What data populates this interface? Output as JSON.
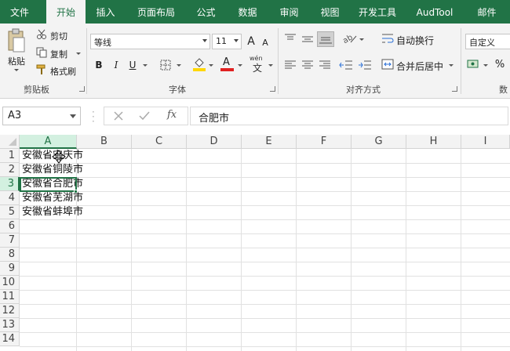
{
  "tabs": [
    "文件",
    "开始",
    "插入",
    "页面布局",
    "公式",
    "数据",
    "审阅",
    "视图",
    "开发工具",
    "AudTool",
    "邮件"
  ],
  "active_tab": "开始",
  "clipboard": {
    "paste": "粘贴",
    "cut": "剪切",
    "copy": "复制",
    "format_painter": "格式刷",
    "group": "剪贴板"
  },
  "font": {
    "name": "等线",
    "size": "11",
    "grow": "A",
    "shrink": "A",
    "bold": "B",
    "italic": "I",
    "underline": "U",
    "font_color": "A",
    "phonetic": "wén",
    "group": "字体"
  },
  "alignment": {
    "wrap_text": "自动换行",
    "merge_center": "合并后居中",
    "group": "对齐方式"
  },
  "number": {
    "format": "自定义",
    "percent": "%",
    "group": "数"
  },
  "formula_bar": {
    "name_box": "A3",
    "fx": "fx",
    "content": "合肥市"
  },
  "columns": [
    "A",
    "B",
    "C",
    "D",
    "E",
    "F",
    "G",
    "H",
    "I"
  ],
  "rows": [
    "1",
    "2",
    "3",
    "4",
    "5",
    "6",
    "7",
    "8",
    "9",
    "10",
    "11",
    "12",
    "13",
    "14"
  ],
  "cells": [
    "安徽省安庆市",
    "安徽省铜陵市",
    "安徽省合肥市",
    "安徽省芜湖市",
    "安徽省蚌埠市"
  ],
  "colors": {
    "excel_green": "#217346",
    "selection_header": "#d3f0e0",
    "font_color_bar": "#e02020",
    "fill_color_bar": "#ffd700"
  }
}
